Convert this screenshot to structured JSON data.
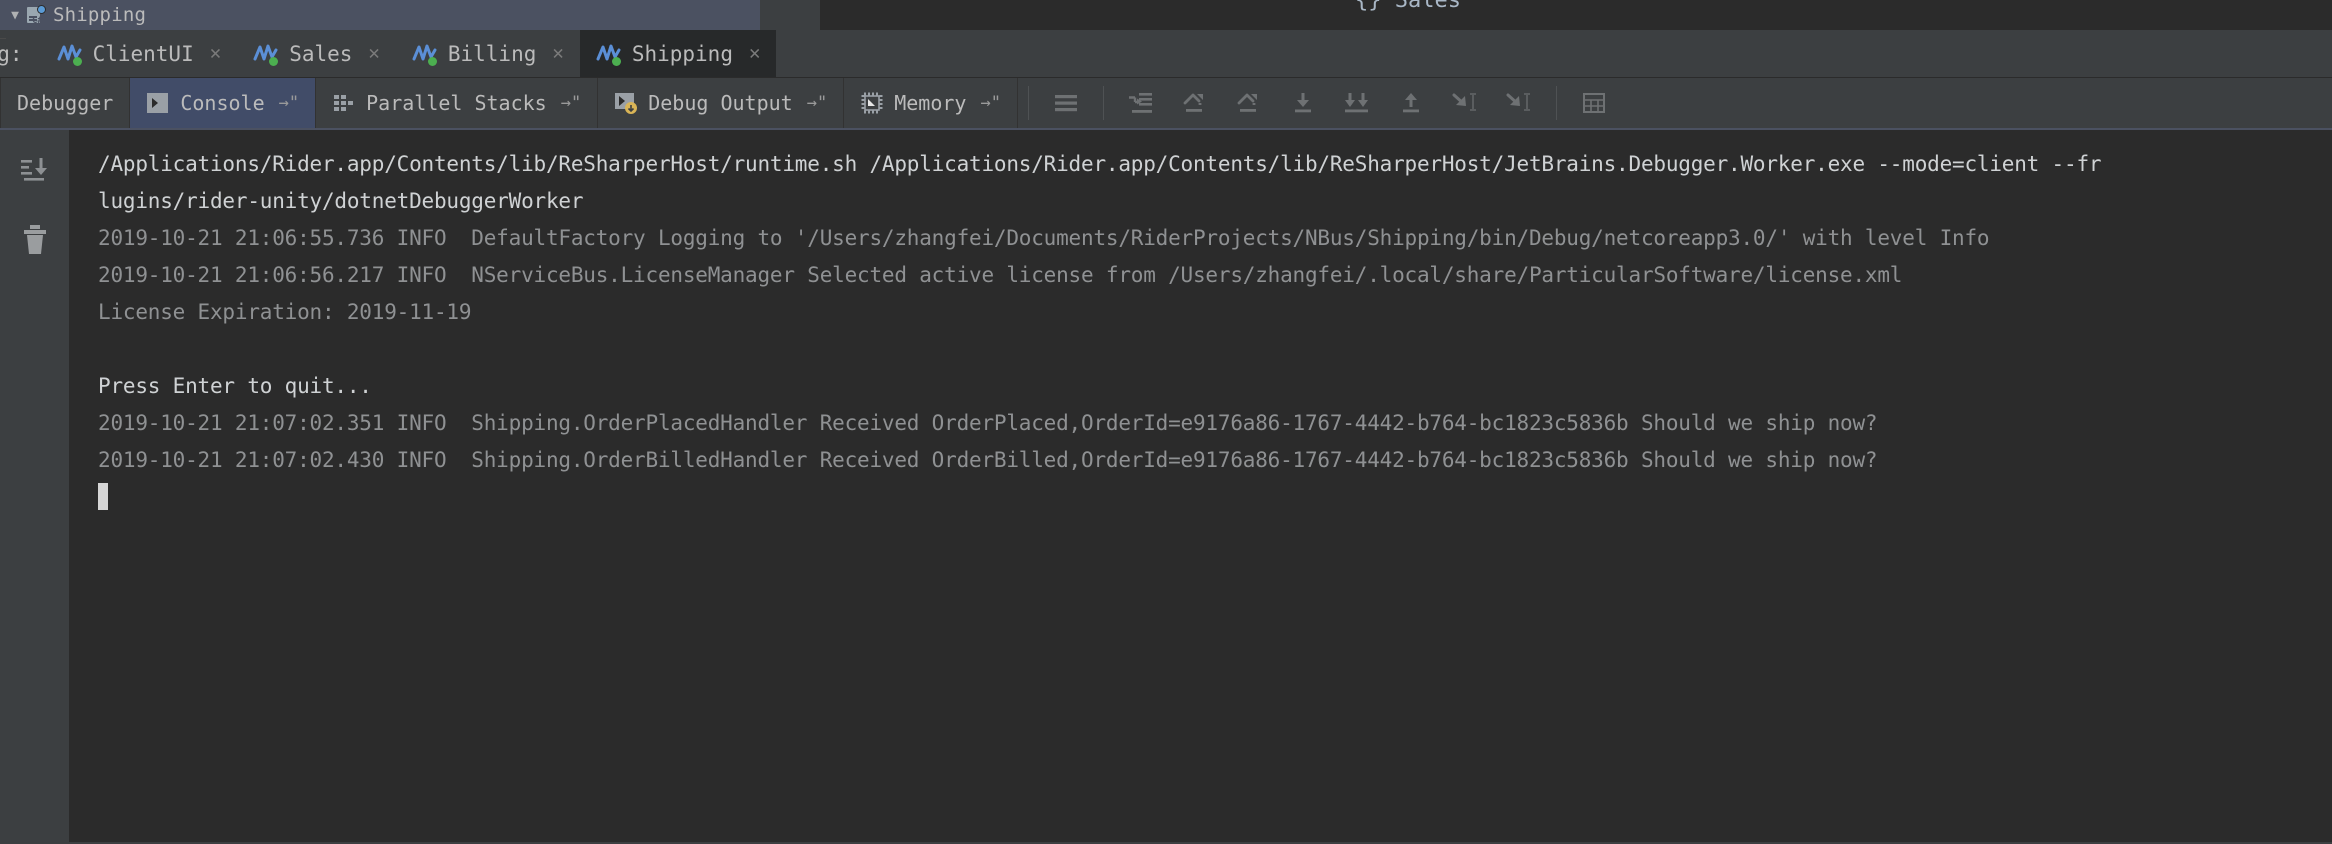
{
  "window": {
    "project_tree": {
      "expand_arrow": "▼",
      "node_label": "Shipping",
      "node_icon": "csharp-project-icon"
    },
    "right_panel_label": "{} Sales"
  },
  "debug_session_bar": {
    "prefix_label": "bug:",
    "tabs": [
      {
        "label": "ClientUI",
        "icon": "nservicebus-running-icon",
        "close": "✕",
        "active": false
      },
      {
        "label": "Sales",
        "icon": "nservicebus-running-icon",
        "close": "✕",
        "active": false
      },
      {
        "label": "Billing",
        "icon": "nservicebus-running-icon",
        "close": "✕",
        "active": false
      },
      {
        "label": "Shipping",
        "icon": "nservicebus-running-icon",
        "close": "✕",
        "active": true
      }
    ]
  },
  "toolbar": {
    "tabs": [
      {
        "label": "Debugger",
        "icon": null,
        "pin": null,
        "active": false
      },
      {
        "label": "Console",
        "icon": "console-icon",
        "pin": "→\"",
        "active": true
      },
      {
        "label": "Parallel Stacks",
        "icon": "parallel-stacks-icon",
        "pin": "→\"",
        "active": false
      },
      {
        "label": "Debug Output",
        "icon": "debug-output-icon",
        "pin": "→\"",
        "active": false
      },
      {
        "label": "Memory",
        "icon": "memory-chip-icon",
        "pin": "→\"",
        "active": false
      }
    ],
    "buttons": [
      {
        "name": "soft-wrap-lines-icon"
      },
      {
        "name": "step-over-icon"
      },
      {
        "name": "step-out-icon"
      },
      {
        "name": "step-out-2-icon"
      },
      {
        "name": "step-into-icon"
      },
      {
        "name": "force-step-into-icon"
      },
      {
        "name": "step-up-icon"
      },
      {
        "name": "run-to-cursor-icon"
      },
      {
        "name": "force-run-to-cursor-icon"
      },
      {
        "name": "evaluate-expression-icon"
      }
    ]
  },
  "gutter": {
    "buttons": [
      {
        "name": "scroll-to-end-icon"
      },
      {
        "name": "clear-all-icon"
      }
    ]
  },
  "console": {
    "lines": [
      {
        "style": "white",
        "text": "/Applications/Rider.app/Contents/lib/ReSharperHost/runtime.sh /Applications/Rider.app/Contents/lib/ReSharperHost/JetBrains.Debugger.Worker.exe --mode=client --fr"
      },
      {
        "style": "white",
        "text": "lugins/rider-unity/dotnetDebuggerWorker"
      },
      {
        "style": "grey",
        "text": "2019-10-21 21:06:55.736 INFO  DefaultFactory Logging to '/Users/zhangfei/Documents/RiderProjects/NBus/Shipping/bin/Debug/netcoreapp3.0/' with level Info"
      },
      {
        "style": "grey",
        "text": "2019-10-21 21:06:56.217 INFO  NServiceBus.LicenseManager Selected active license from /Users/zhangfei/.local/share/ParticularSoftware/license.xml"
      },
      {
        "style": "grey",
        "text": "License Expiration: 2019-11-19"
      },
      {
        "style": "blank",
        "text": ""
      },
      {
        "style": "white",
        "text": "Press Enter to quit..."
      },
      {
        "style": "grey",
        "text": "2019-10-21 21:07:02.351 INFO  Shipping.OrderPlacedHandler Received OrderPlaced,OrderId=e9176a86-1767-4442-b764-bc1823c5836b Should we ship now?"
      },
      {
        "style": "grey",
        "text": "2019-10-21 21:07:02.430 INFO  Shipping.OrderBilledHandler Received OrderBilled,OrderId=e9176a86-1767-4442-b764-bc1823c5836b Should we ship now?"
      }
    ]
  },
  "colors": {
    "background": "#2b2b2b",
    "chrome": "#3c3f41",
    "tab_active": "#414c68",
    "tree_selected": "#4b5161",
    "text_primary": "#cfd2d4",
    "text_secondary": "#8f9193",
    "running_led": "#4caf50",
    "accent_blue": "#5b9bd5"
  }
}
